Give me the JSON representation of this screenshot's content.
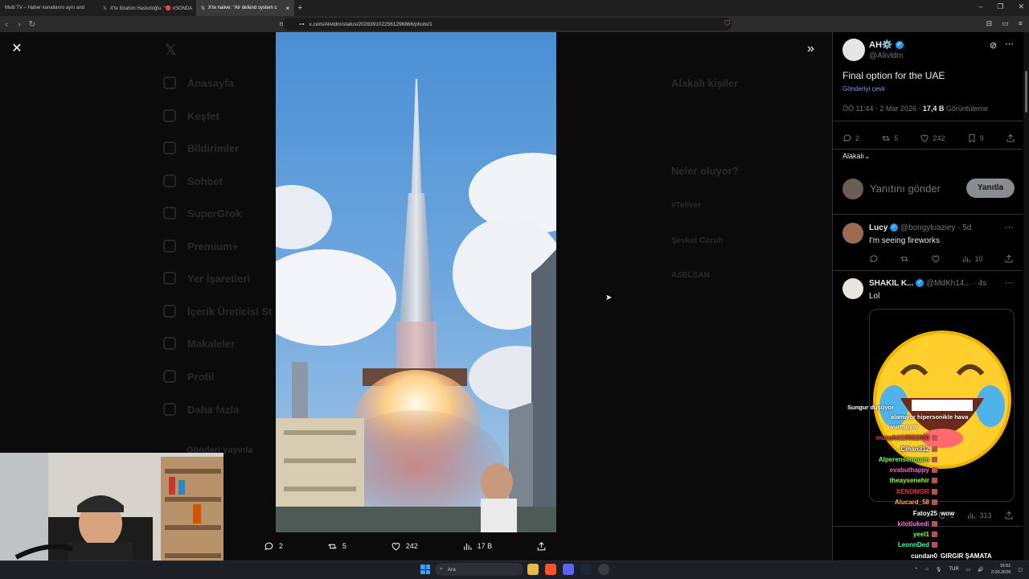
{
  "browser": {
    "tabs": [
      {
        "label": "Multi TV – Haber kanallarını aynı and",
        "active": false
      },
      {
        "label": "X'te İbrahim Haskoloğlu: \"🔴 #SONDA",
        "active": false
      },
      {
        "label": "X'te naiive: \"Air defend system c",
        "active": true
      }
    ],
    "url": "x.com/Alivldm/status/2028391022561296866/photo/1"
  },
  "background_page": {
    "nav": [
      "Anasayfa",
      "Keşfet",
      "Bildirimler",
      "Sohbet",
      "SuperGrok",
      "Premium+",
      "Yer İşaretleri",
      "İçerik Üreticisi St",
      "Makaleler",
      "Profil",
      "Daha fazla"
    ],
    "post_button": "Gönderi yayınla",
    "related_title": "Alakalı kişiler",
    "whats_happening": "Neler oluyor?",
    "trend_1": "#Teliver",
    "trend_2": "Şevket Coruh",
    "trend_3": "ASELSAN"
  },
  "photo_actions": {
    "replies": "2",
    "reposts": "5",
    "likes": "242",
    "views": "17 B"
  },
  "tweet": {
    "author_name": "AH⚙️",
    "author_handle": "@Alivldm",
    "text": "Final option for the UAE",
    "translate": "Gönderiyi çevir",
    "time": "ÖÖ 11:44 · 2 Mar 2026 · ",
    "views_count": "17,4 B",
    "views_label": " Görüntüleme",
    "replies": "2",
    "reposts": "5",
    "likes": "242",
    "bookmarks": "9",
    "sort": "Alakalı",
    "reply_placeholder": "Yanıtını gönder",
    "reply_button": "Yanıtla"
  },
  "replies": [
    {
      "name": "Lucy",
      "handle": "@bongyluaziey",
      "time": "· 5d",
      "text": "I'm seeing fireworks",
      "views": "10"
    },
    {
      "name": "SHAKIL K...",
      "handle": "@MdKh14...",
      "time": "· 4s",
      "text": "Lol",
      "likes": "1",
      "views": "313"
    }
  ],
  "chat": {
    "overlay_text_1": "Sungur düşüyor",
    "overlay_text_2": "alamıyor hipersonikle hava",
    "overlay_text_3": "vurmuyor",
    "users": [
      {
        "name": "mucahit19982000",
        "color": "#ff3b3b",
        "msg": ""
      },
      {
        "name": "Cihan312",
        "color": "#ffffff",
        "msg": ""
      },
      {
        "name": "Alperensengunn",
        "color": "#7cff4d",
        "msg": ""
      },
      {
        "name": "evabuthappy",
        "color": "#ff5cc8",
        "msg": ""
      },
      {
        "name": "theaysenehir",
        "color": "#9cff3b",
        "msg": ""
      },
      {
        "name": "XENOMOR",
        "color": "#ff2d2d",
        "msg": ""
      },
      {
        "name": "Alucard_58",
        "color": "#ffb347",
        "msg": ""
      },
      {
        "name": "Fatoy25",
        "color": "#ffffff",
        "msg": "wow"
      },
      {
        "name": "kilotlukedi",
        "color": "#ff6bd6",
        "msg": ""
      },
      {
        "name": "yeel1",
        "color": "#7cff4d",
        "msg": ""
      },
      {
        "name": "LeonnDed",
        "color": "#3bffb0",
        "msg": ""
      },
      {
        "name": "cundan0",
        "color": "#ffffff",
        "msg": "GIRGIR ŞAMATA"
      },
      {
        "name": "Alperensengunn",
        "color": "#7cff4d",
        "msg": ""
      }
    ]
  },
  "taskbar": {
    "search": "Ara",
    "lang": "TUR",
    "time": "16:51",
    "date": "2.03.2026"
  },
  "colors": {
    "accent": "#1d9bf0",
    "panel_bg": "#000000",
    "link": "#8b98f9"
  }
}
